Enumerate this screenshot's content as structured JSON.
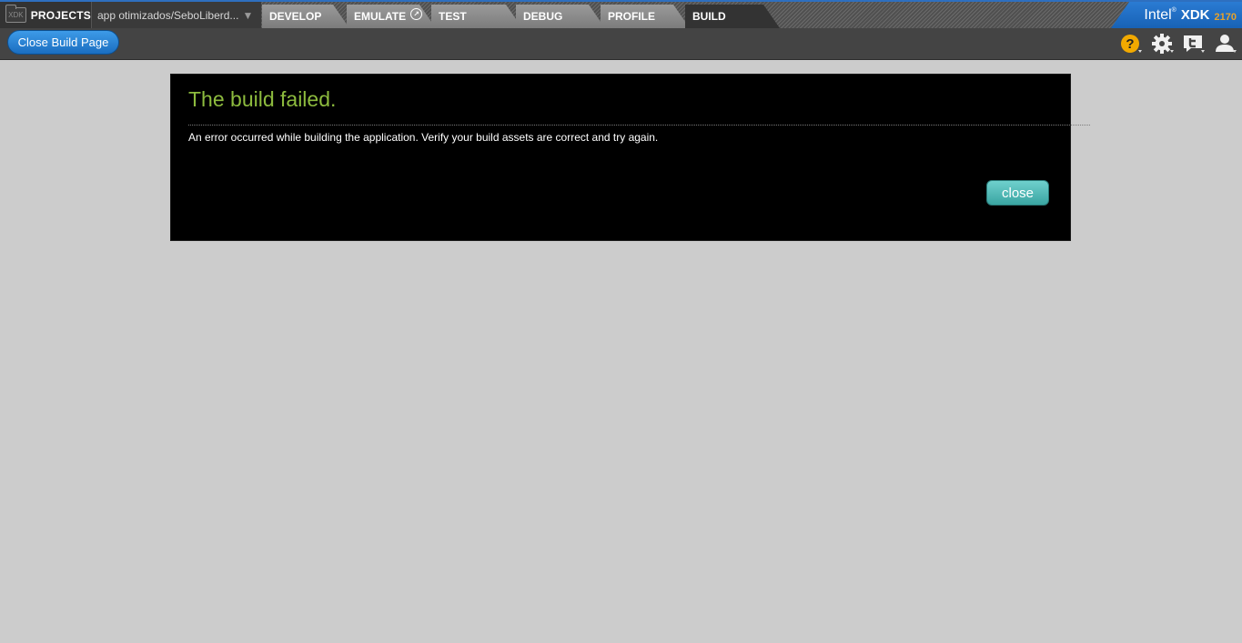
{
  "topbar": {
    "projects_label": "PROJECTS",
    "project_name": "app otimizados/SeboLiberd...",
    "tabs": [
      {
        "label": "DEVELOP"
      },
      {
        "label": "EMULATE"
      },
      {
        "label": "TEST"
      },
      {
        "label": "DEBUG"
      },
      {
        "label": "PROFILE"
      },
      {
        "label": "BUILD",
        "active": true
      }
    ],
    "brand": {
      "name": "Intel",
      "product": "XDK",
      "version": "2170"
    }
  },
  "toolbar": {
    "close_build_label": "Close Build Page",
    "icons": [
      "help-icon",
      "gear-icon",
      "twitter-icon",
      "user-icon"
    ]
  },
  "dialog": {
    "title": "The build failed.",
    "message": "An error occurred while building the application. Verify your build assets are correct and try again.",
    "close_label": "close"
  },
  "colors": {
    "title_green": "#8dbb3e",
    "help_orange": "#f2a900",
    "brand_blue": "#1f6ec7",
    "close_teal": "#4fb8b5",
    "button_blue": "#2a82d6"
  }
}
